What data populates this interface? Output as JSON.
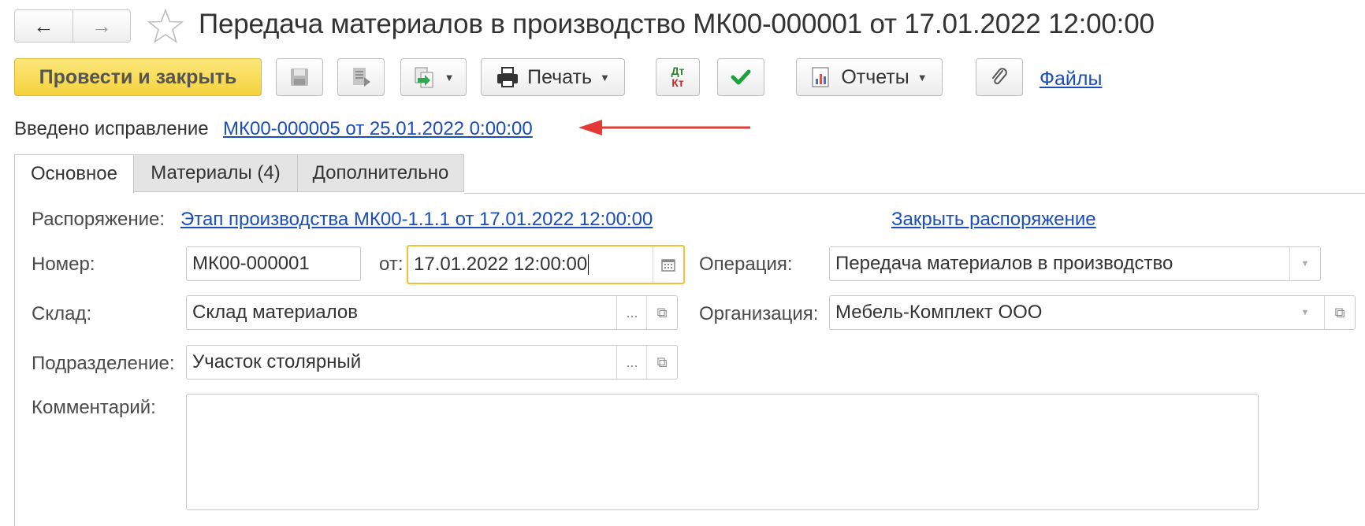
{
  "window": {
    "title": "Передача материалов в производство МК00-000001 от 17.01.2022 12:00:00"
  },
  "toolbar": {
    "post_close_label": "Провести и закрыть",
    "print_label": "Печать",
    "dt_label": "Дт",
    "kt_label": "Кт",
    "reports_label": "Отчеты",
    "files_label": "Файлы"
  },
  "correction": {
    "prefix": "Введено исправление",
    "link": "МК00-000005 от 25.01.2022 0:00:00",
    "arrow_color": "#e53935"
  },
  "tabs": [
    {
      "label": "Основное",
      "active": true
    },
    {
      "label": "Материалы (4)",
      "active": false
    },
    {
      "label": "Дополнительно",
      "active": false
    }
  ],
  "form": {
    "order_label": "Распоряжение:",
    "order_link": "Этап производства МК00-1.1.1 от 17.01.2022 12:00:00",
    "close_order_link": "Закрыть распоряжение",
    "number_label": "Номер:",
    "number_value": "МК00-000001",
    "date_label": "от:",
    "date_value": "17.01.2022 12:00:00",
    "operation_label": "Операция:",
    "operation_value": "Передача материалов в производство",
    "warehouse_label": "Склад:",
    "warehouse_value": "Склад материалов",
    "organization_label": "Организация:",
    "organization_value": "Мебель-Комплект ООО",
    "department_label": "Подразделение:",
    "department_value": "Участок столярный",
    "comment_label": "Комментарий:",
    "comment_value": ""
  },
  "colors": {
    "primary_button": "#f4d23d",
    "link": "#1a4dbd",
    "focus_border": "#f1c232",
    "check_green": "#1aa33a"
  }
}
